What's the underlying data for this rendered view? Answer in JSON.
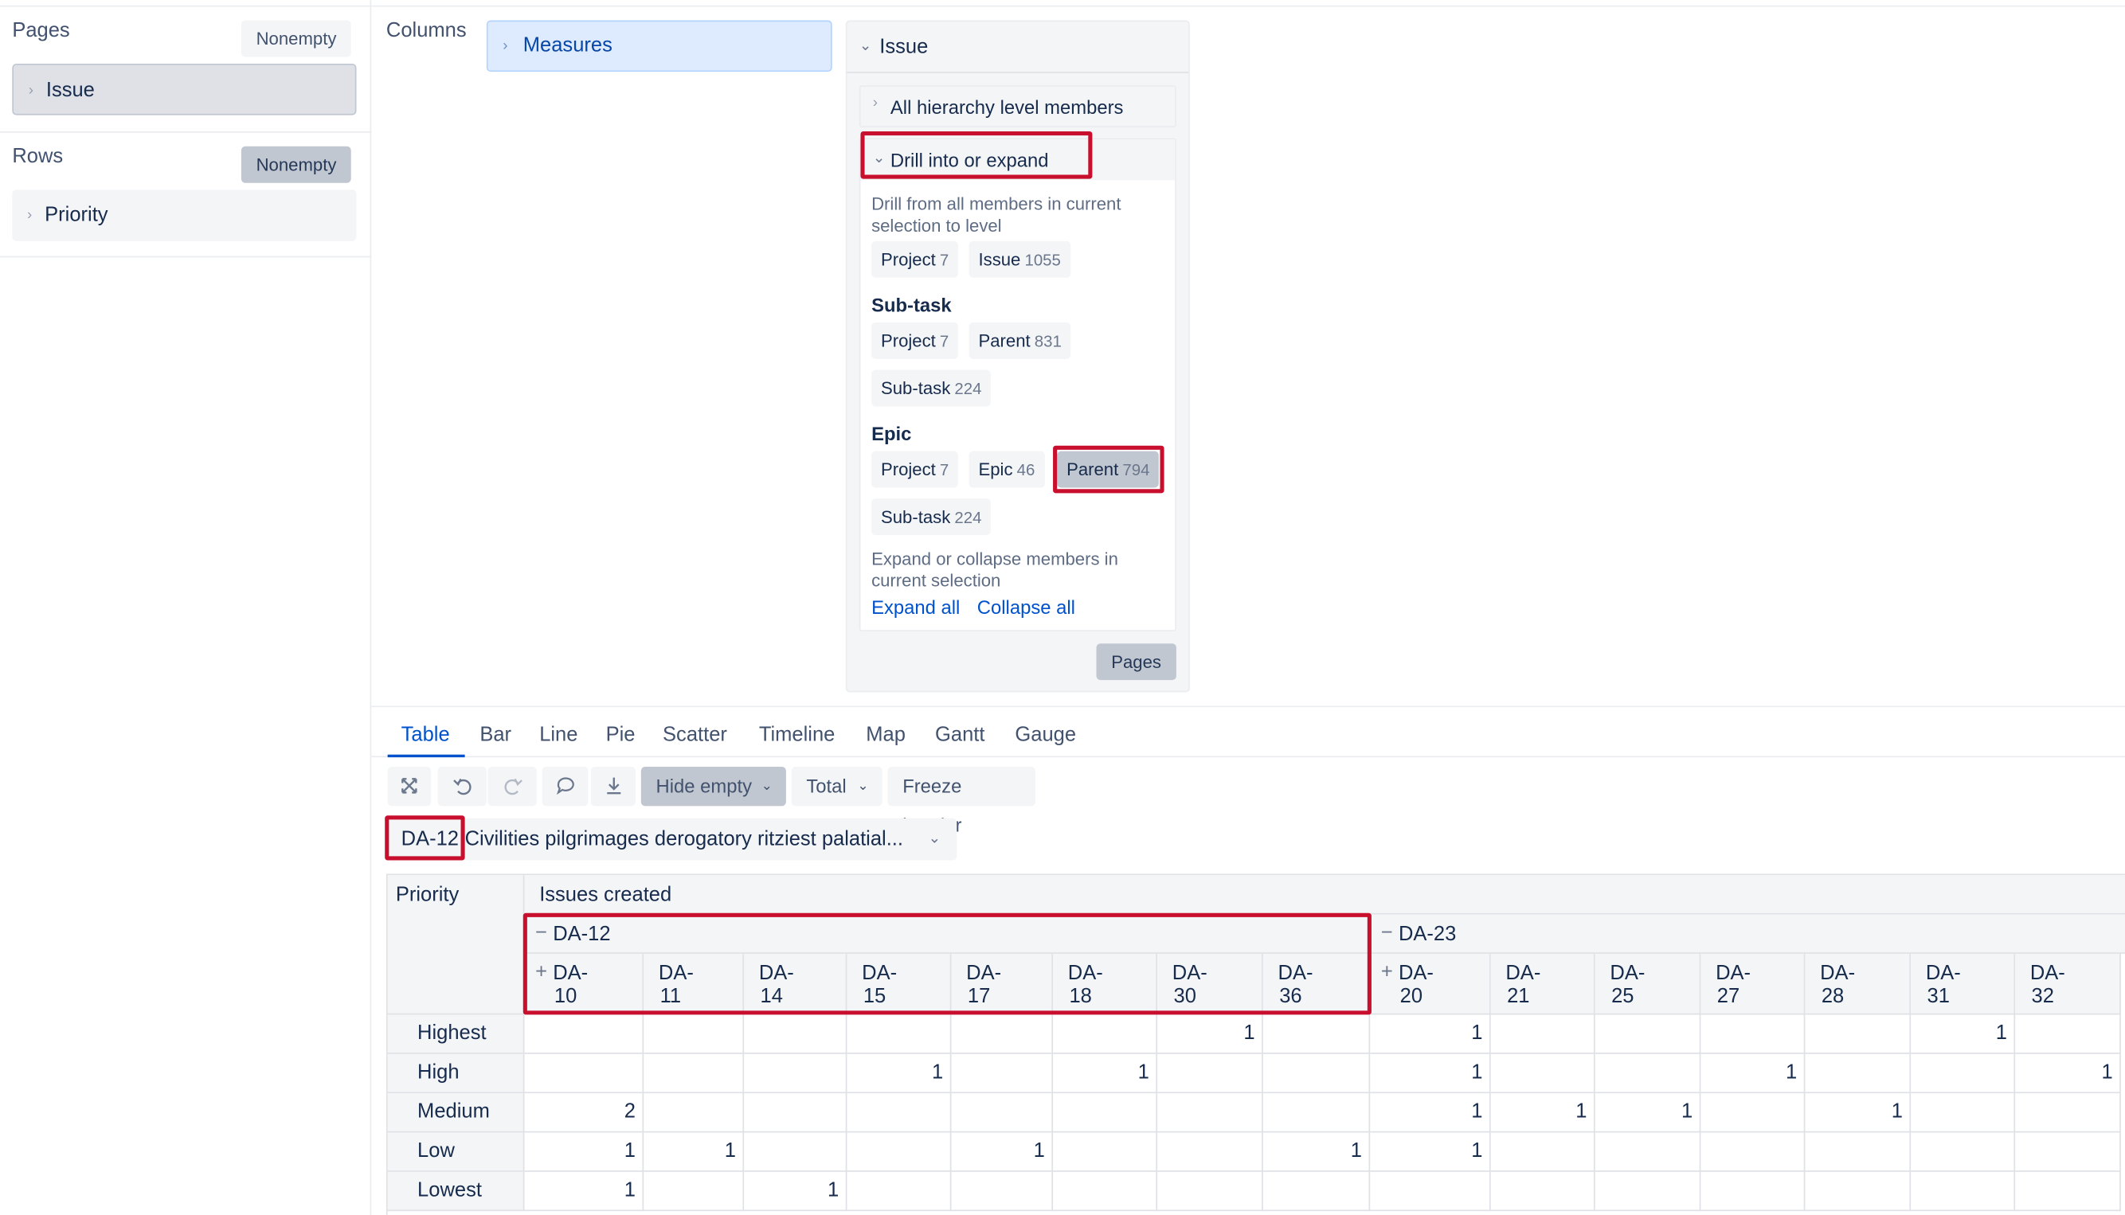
{
  "left_panel": {
    "pages_label": "Pages",
    "pages_nonempty": "Nonempty",
    "pages_dimension": "Issue",
    "rows_label": "Rows",
    "rows_nonempty": "Nonempty",
    "rows_dimension": "Priority"
  },
  "columns": {
    "label": "Columns",
    "dimension": "Measures"
  },
  "issue_panel": {
    "title": "Issue",
    "all_members": "All hierarchy level members",
    "drill_title": "Drill into or expand",
    "drill_desc_1": "Drill from all members in current",
    "drill_desc_2": "selection to level",
    "default_levels": [
      {
        "name": "Project",
        "count": "7"
      },
      {
        "name": "Issue",
        "count": "1055"
      }
    ],
    "subtask_heading": "Sub-task",
    "subtask_levels": [
      {
        "name": "Project",
        "count": "7"
      },
      {
        "name": "Parent",
        "count": "831"
      },
      {
        "name": "Sub-task",
        "count": "224"
      }
    ],
    "epic_heading": "Epic",
    "epic_levels": [
      {
        "name": "Project",
        "count": "7"
      },
      {
        "name": "Epic",
        "count": "46"
      },
      {
        "name": "Parent",
        "count": "794"
      },
      {
        "name": "Sub-task",
        "count": "224"
      }
    ],
    "expand_desc_1": "Expand or collapse members in",
    "expand_desc_2": "current selection",
    "expand_all": "Expand all",
    "collapse_all": "Collapse all",
    "pages_button": "Pages"
  },
  "tabs": [
    "Table",
    "Bar",
    "Line",
    "Pie",
    "Scatter",
    "Timeline",
    "Map",
    "Gantt",
    "Gauge"
  ],
  "toolbar": {
    "hide_empty": "Hide empty",
    "total": "Total",
    "freeze_header": "Freeze header"
  },
  "page_selector": {
    "key": "DA-12",
    "title": "Civilities pilgrimages derogatory ritziest palatial..."
  },
  "report": {
    "row_dim_header": "Priority",
    "measure_header": "Issues created",
    "groups": [
      {
        "label": "DA-12",
        "toggle": "−"
      },
      {
        "label": "DA-23",
        "toggle": "−"
      }
    ],
    "columns": [
      {
        "l1": "DA-",
        "l2": "10",
        "toggle": "+"
      },
      {
        "l1": "DA-",
        "l2": "11",
        "toggle": ""
      },
      {
        "l1": "DA-",
        "l2": "14",
        "toggle": ""
      },
      {
        "l1": "DA-",
        "l2": "15",
        "toggle": ""
      },
      {
        "l1": "DA-",
        "l2": "17",
        "toggle": ""
      },
      {
        "l1": "DA-",
        "l2": "18",
        "toggle": ""
      },
      {
        "l1": "DA-",
        "l2": "30",
        "toggle": ""
      },
      {
        "l1": "DA-",
        "l2": "36",
        "toggle": ""
      },
      {
        "l1": "DA-",
        "l2": "20",
        "toggle": "+"
      },
      {
        "l1": "DA-",
        "l2": "21",
        "toggle": ""
      },
      {
        "l1": "DA-",
        "l2": "25",
        "toggle": ""
      },
      {
        "l1": "DA-",
        "l2": "27",
        "toggle": ""
      },
      {
        "l1": "DA-",
        "l2": "28",
        "toggle": ""
      },
      {
        "l1": "DA-",
        "l2": "31",
        "toggle": ""
      },
      {
        "l1": "DA-",
        "l2": "32",
        "toggle": ""
      }
    ],
    "rows": [
      {
        "label": "Highest",
        "values": [
          "",
          "",
          "",
          "",
          "",
          "",
          "1",
          "",
          "1",
          "",
          "",
          "",
          "",
          "1",
          ""
        ]
      },
      {
        "label": "High",
        "values": [
          "",
          "",
          "",
          "1",
          "",
          "1",
          "",
          "",
          "1",
          "",
          "",
          "1",
          "",
          "",
          "1"
        ]
      },
      {
        "label": "Medium",
        "values": [
          "2",
          "",
          "",
          "",
          "",
          "",
          "",
          "",
          "1",
          "1",
          "1",
          "",
          "1",
          "",
          ""
        ]
      },
      {
        "label": "Low",
        "values": [
          "1",
          "1",
          "",
          "",
          "1",
          "",
          "",
          "1",
          "1",
          "",
          "",
          "",
          "",
          "",
          ""
        ]
      },
      {
        "label": "Lowest",
        "values": [
          "1",
          "",
          "1",
          "",
          "",
          "",
          "",
          "",
          "",
          "",
          "",
          "",
          "",
          "",
          ""
        ]
      }
    ]
  }
}
